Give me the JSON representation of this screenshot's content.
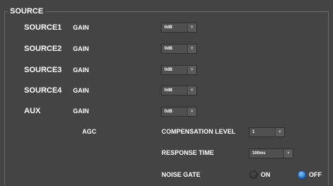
{
  "section": {
    "title": "SOURCE"
  },
  "sources": [
    {
      "name": "SOURCE1",
      "gain_label": "GAIN",
      "gain_value": "0dB"
    },
    {
      "name": "SOURCE2",
      "gain_label": "GAIN",
      "gain_value": "0dB"
    },
    {
      "name": "SOURCE3",
      "gain_label": "GAIN",
      "gain_value": "0dB"
    },
    {
      "name": "SOURCE4",
      "gain_label": "GAIN",
      "gain_value": "0dB"
    },
    {
      "name": "AUX",
      "gain_label": "GAIN",
      "gain_value": "0dB"
    }
  ],
  "agc": {
    "label": "AGC",
    "compensation_level": {
      "label": "COMPENSATION LEVEL",
      "value": "1"
    },
    "response_time": {
      "label": "RESPONSE TIME",
      "value": "100ms"
    },
    "noise_gate": {
      "label": "NOISE GATE",
      "on_label": "ON",
      "off_label": "OFF",
      "selected": "OFF"
    }
  },
  "dropdown_arrow": "▼",
  "colors": {
    "background": "#444445",
    "radio_selected": "#2f7fd6"
  }
}
